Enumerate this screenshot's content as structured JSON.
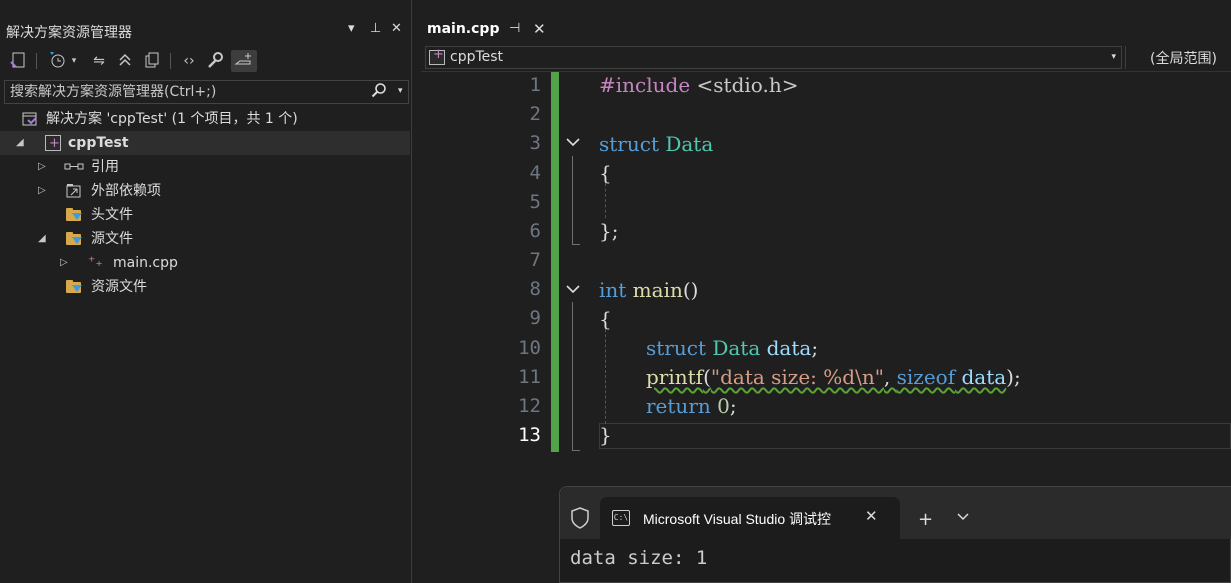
{
  "solution_explorer": {
    "title": "解决方案资源管理器",
    "controls": {
      "dropdown": "▾",
      "pin": "⊥",
      "close": "✕"
    },
    "search": {
      "placeholder": "搜索解决方案资源管理器(Ctrl+;)"
    },
    "tree": {
      "solution": "解决方案 'cppTest' (1 个项目，共 1 个)",
      "project": "cppTest",
      "references": "引用",
      "external_deps": "外部依赖项",
      "header_files": "头文件",
      "source_files": "源文件",
      "main_cpp": "main.cpp",
      "resource_files": "资源文件"
    }
  },
  "editor": {
    "tab": {
      "label": "main.cpp",
      "pin": "⊣",
      "close": "✕"
    },
    "nav": {
      "project": "cppTest",
      "scope": "(全局范围)"
    },
    "current_line": 13,
    "line_numbers": [
      "1",
      "2",
      "3",
      "4",
      "5",
      "6",
      "7",
      "8",
      "9",
      "10",
      "11",
      "12",
      "13"
    ],
    "code": {
      "l1_directive": "#include",
      "l1_header": " <stdio.h>",
      "l3_kw": "struct",
      "l3_name": " Data",
      "l4": "{",
      "l6": "};",
      "l8_kw": "int",
      "l8_fn": " main",
      "l8_paren": "()",
      "l9": "{",
      "l10_kw": "struct",
      "l10_type": " Data",
      "l10_var": " data",
      "l10_end": ";",
      "l11_fn": "printf",
      "l11_open": "(",
      "l11_str": "\"data size: %d\\n\"",
      "l11_comma": ", ",
      "l11_kw": "sizeof",
      "l11_var": " data",
      "l11_close": ");",
      "l12_kw": "return",
      "l12_num": " 0",
      "l12_end": ";",
      "l13": "}"
    }
  },
  "console": {
    "tab_title": "Microsoft Visual Studio 调试控",
    "output": "data size: 1"
  },
  "colors": {
    "background": "#1f1f1f",
    "keyword": "#569cd6",
    "type": "#4ec9b0",
    "function": "#dcdcaa",
    "string": "#d69d85",
    "change_bar": "#53a34a"
  }
}
